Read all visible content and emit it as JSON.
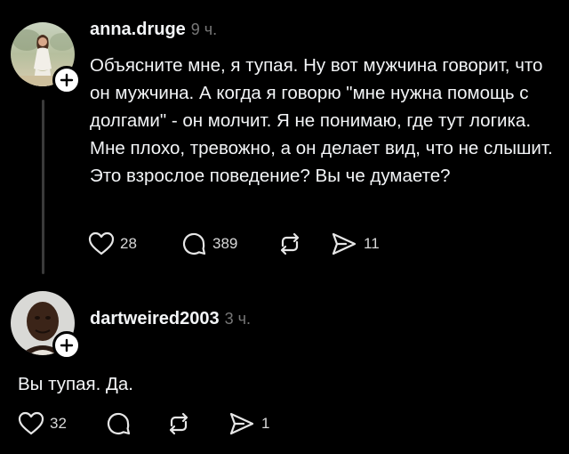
{
  "posts": [
    {
      "username": "anna.druge",
      "time": "9 ч.",
      "text": "Объясните мне, я тупая. Ну вот мужчина говорит, что он мужчина. А когда я говорю \"мне нужна помощь с долгами\" - он молчит. Я не понимаю, где тут логика. Мне плохо, тревожно, а он делает вид, что не слышит. Это взрослое поведение? Вы че думаете?",
      "likes": "28",
      "replies": "389",
      "reposts": "",
      "shares": "11"
    },
    {
      "username": "dartweired2003",
      "time": "3 ч.",
      "text": "Вы тупая. Да.",
      "likes": "32",
      "replies": "",
      "reposts": "",
      "shares": "1"
    }
  ],
  "colors": {
    "background": "#000000",
    "text": "#f3f5f7",
    "muted": "#777777",
    "thread_line": "#3a3a3a"
  },
  "icons": [
    "plus-icon",
    "heart-icon",
    "comment-icon",
    "repost-icon",
    "share-icon"
  ]
}
